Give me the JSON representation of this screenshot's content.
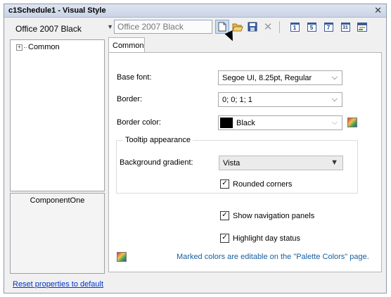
{
  "window": {
    "title": "c1Schedule1 - Visual Style",
    "close_glyph": "✕"
  },
  "toolbar": {
    "style_select": "Office 2007 Black",
    "style_name_input": "Office 2007 Black",
    "icons": [
      "new-icon",
      "open-icon",
      "save-icon",
      "delete-icon",
      "day-view-icon",
      "work-week-view-icon",
      "week-view-icon",
      "month-view-icon",
      "timeline-view-icon"
    ],
    "cal_labels": {
      "day": "1",
      "work_week": "5",
      "week": "7",
      "month": "31"
    }
  },
  "tree": {
    "root_label": "Common",
    "expander": "+"
  },
  "logo": {
    "label": "ComponentOne"
  },
  "tabs": [
    {
      "label": "Common"
    }
  ],
  "form": {
    "base_font": {
      "label": "Base font:",
      "value": "Segoe UI, 8.25pt, Regular"
    },
    "border": {
      "label": "Border:",
      "value": "0; 0; 1; 1"
    },
    "border_color": {
      "label": "Border color:",
      "value": "Black",
      "swatch": "#000000"
    },
    "tooltip": {
      "legend": "Tooltip appearance",
      "background_gradient": {
        "label": "Background gradient:",
        "value": "Vista"
      },
      "rounded_corners": {
        "label": "Rounded corners",
        "checked": true
      }
    },
    "show_navigation_panels": {
      "label": "Show navigation panels",
      "checked": true
    },
    "highlight_day_status": {
      "label": "Highlight day status",
      "checked": true
    },
    "note": "Marked colors are editable on the \"Palette Colors\" page."
  },
  "footer": {
    "reset_link": "Reset properties to default"
  },
  "glyphs": {
    "check": "✓",
    "dropdown_arrow": "⌵",
    "small_arrow": "▼"
  }
}
